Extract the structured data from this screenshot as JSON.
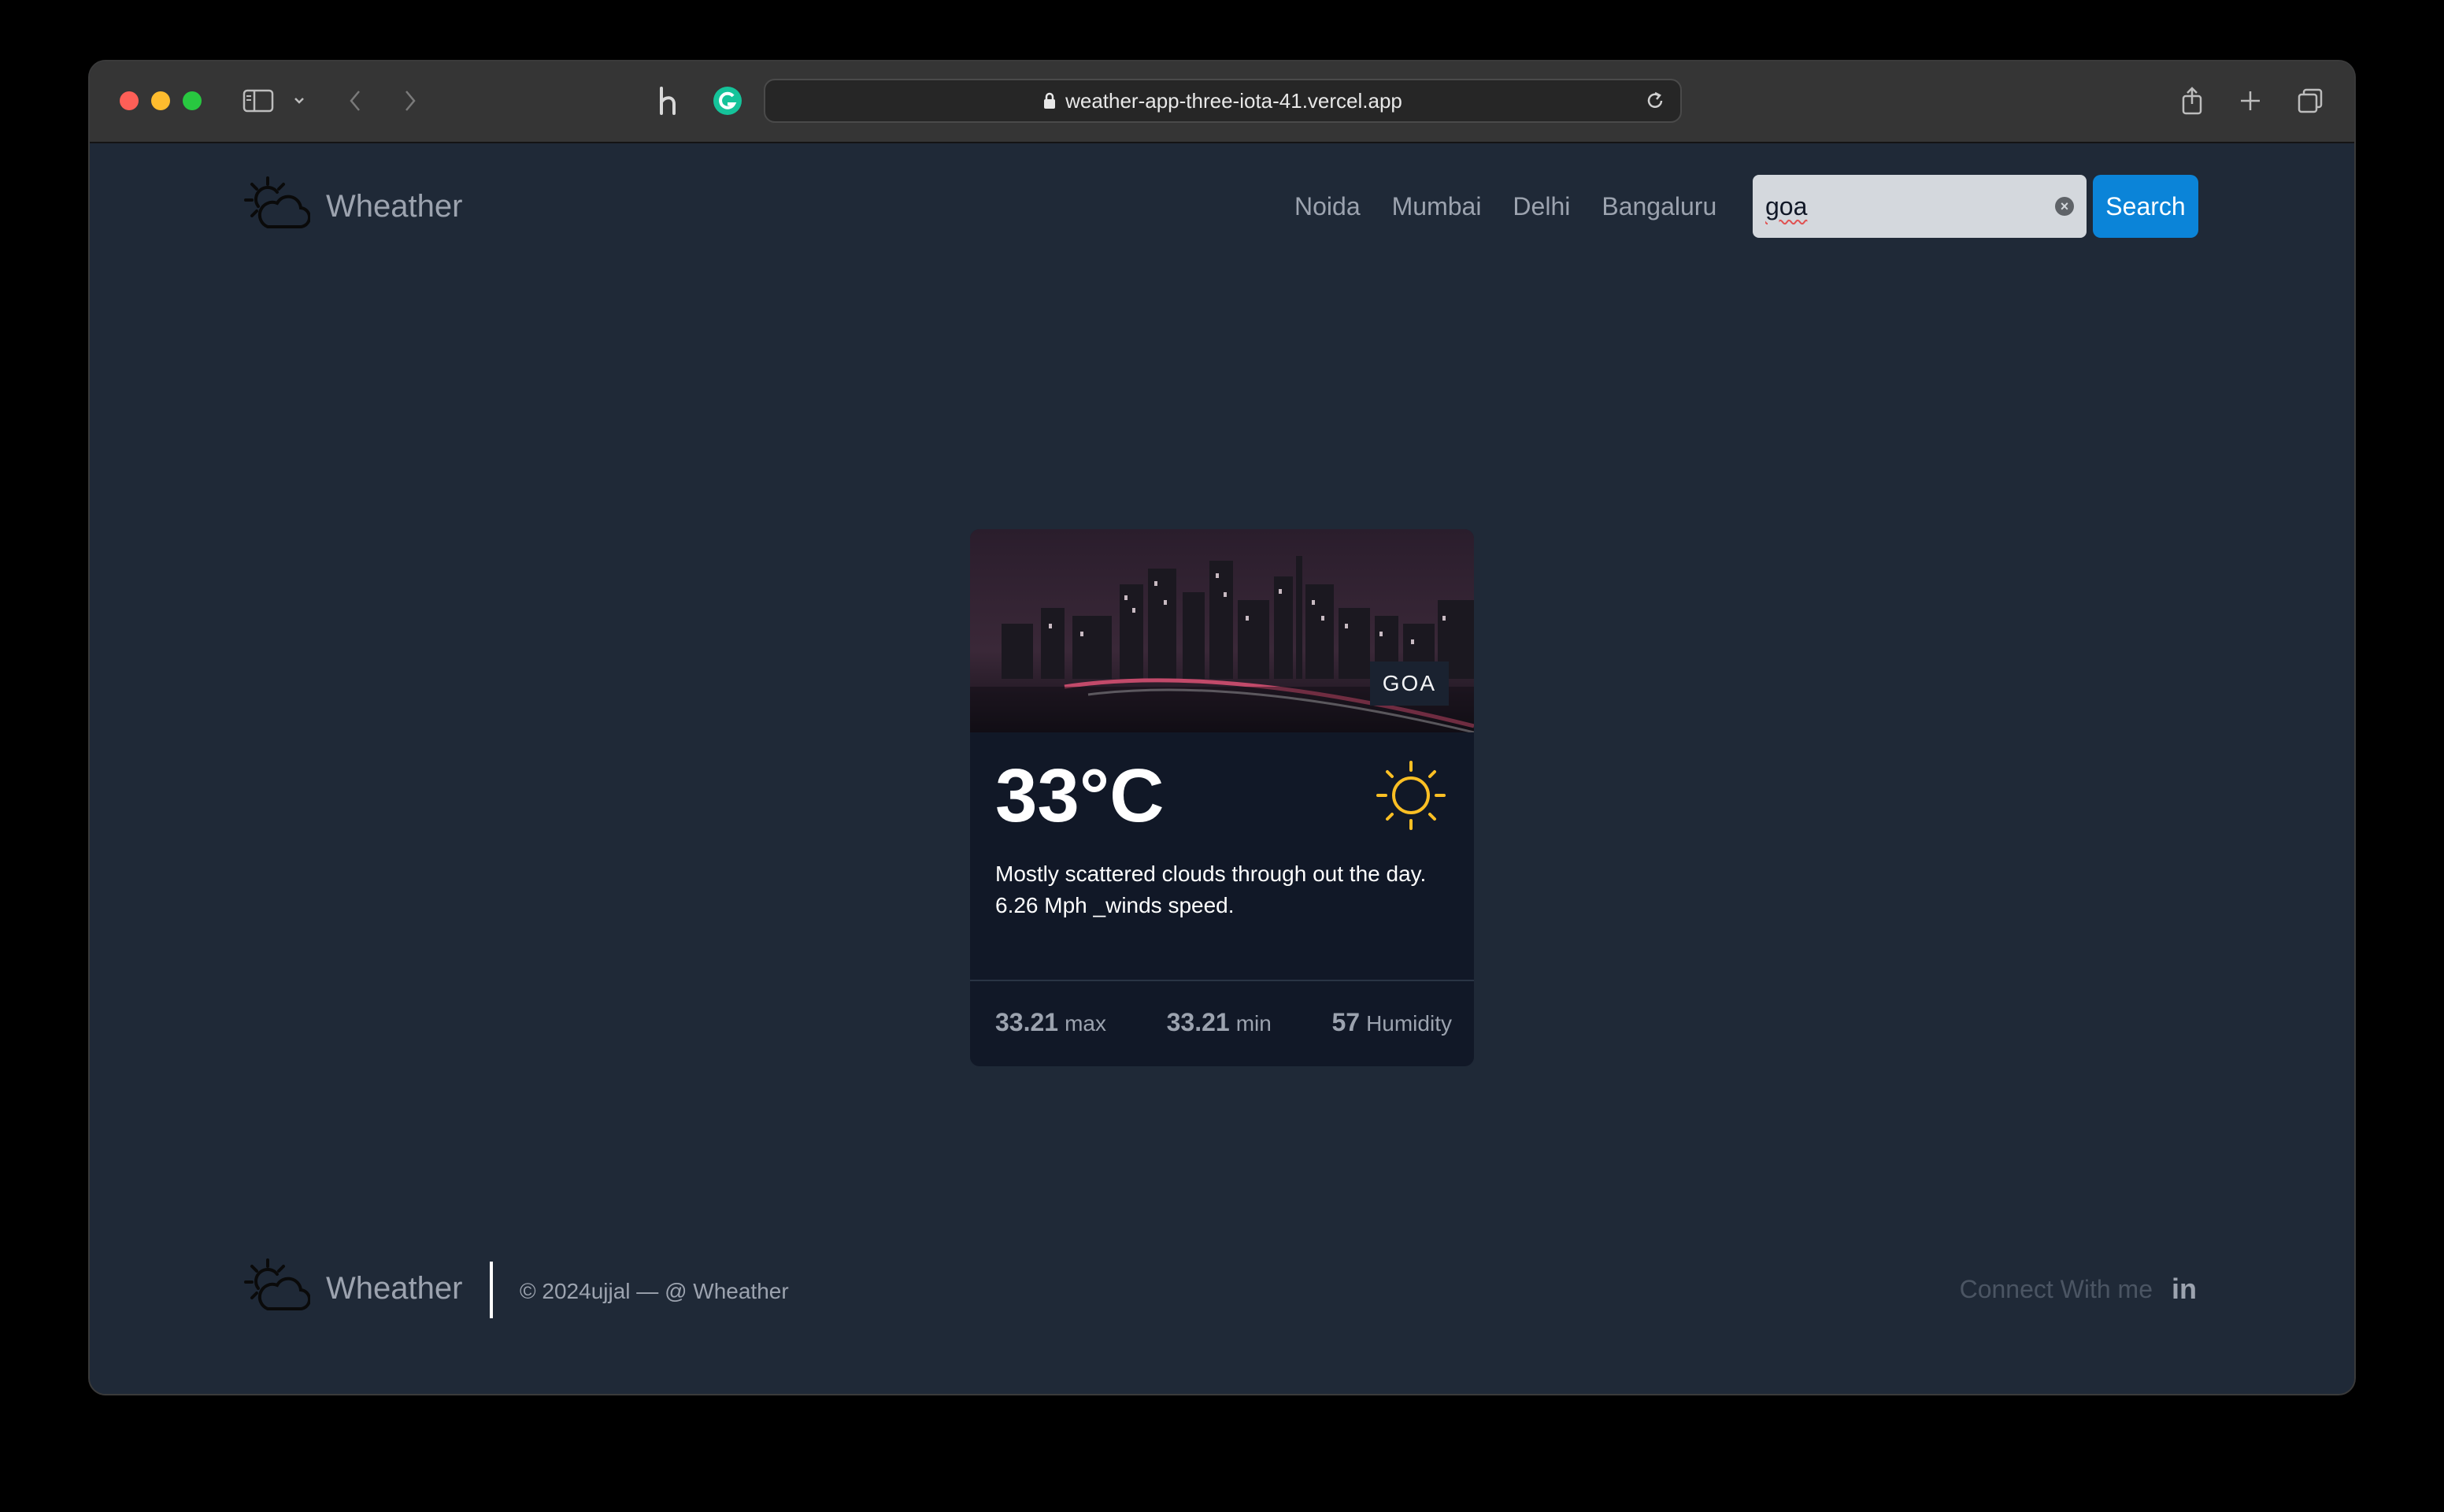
{
  "browser": {
    "url": "weather-app-three-iota-41.vercel.app"
  },
  "navbar": {
    "logo_text": "Wheather",
    "links": [
      "Noida",
      "Mumbai",
      "Delhi",
      "Bangaluru"
    ],
    "search_value": "goa",
    "search_button": "Search"
  },
  "weather_card": {
    "city": "GOA",
    "temperature": "33°C",
    "description": "Mostly scattered clouds through out the day.",
    "wind": "6.26 Mph _winds speed.",
    "max_value": "33.21",
    "max_label": "max",
    "min_value": "33.21",
    "min_label": "min",
    "humidity_value": "57",
    "humidity_label": "Humidity",
    "icon": "sun-icon",
    "sun_color": "#fbbf24"
  },
  "footer": {
    "logo_text": "Wheather",
    "copyright": "© 2024ujjal — @ Wheather",
    "connect_text": "Connect With me",
    "social_icon": "linkedin-icon"
  },
  "colors": {
    "page_bg": "#1f2937",
    "card_bg": "#111827",
    "accent": "#0b84d8"
  }
}
